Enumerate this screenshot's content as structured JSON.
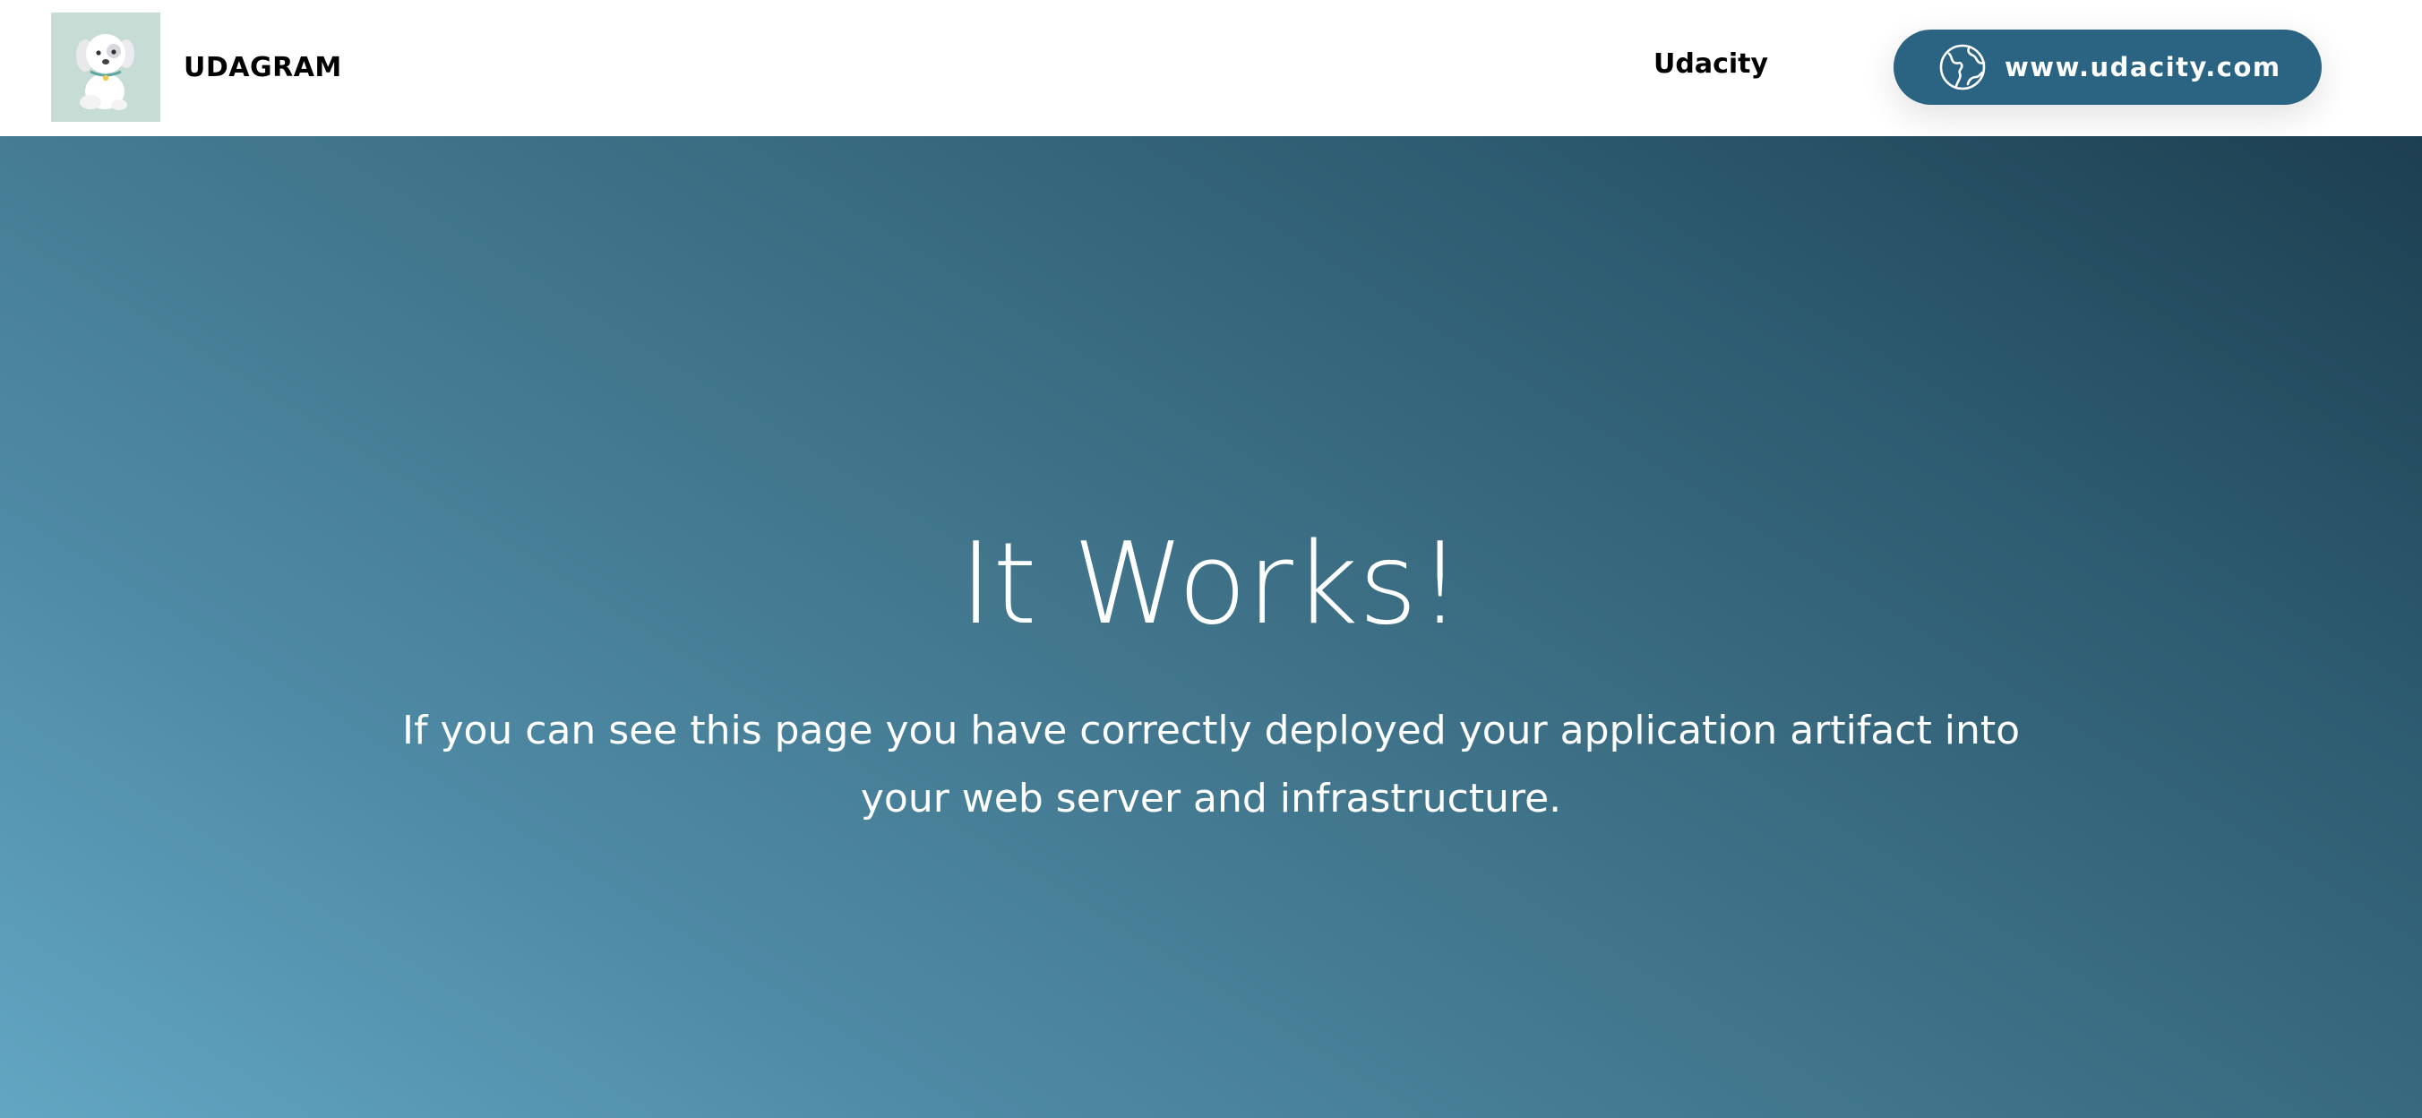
{
  "navbar": {
    "logo_icon": "puppy-logo-icon",
    "brand_name": "UDAGRAM",
    "link_label": "Udacity",
    "site_button": {
      "icon": "globe-icon",
      "label": "www.udacity.com"
    }
  },
  "hero": {
    "title": "It Works!",
    "text": "If you can see this page you have correctly deployed your application artifact into your web server and infrastructure."
  },
  "colors": {
    "button": "#2b6482",
    "logo_background": "#c7dcd4",
    "gradient_light": "#62a6c3",
    "gradient_dark": "#1d3f51"
  }
}
